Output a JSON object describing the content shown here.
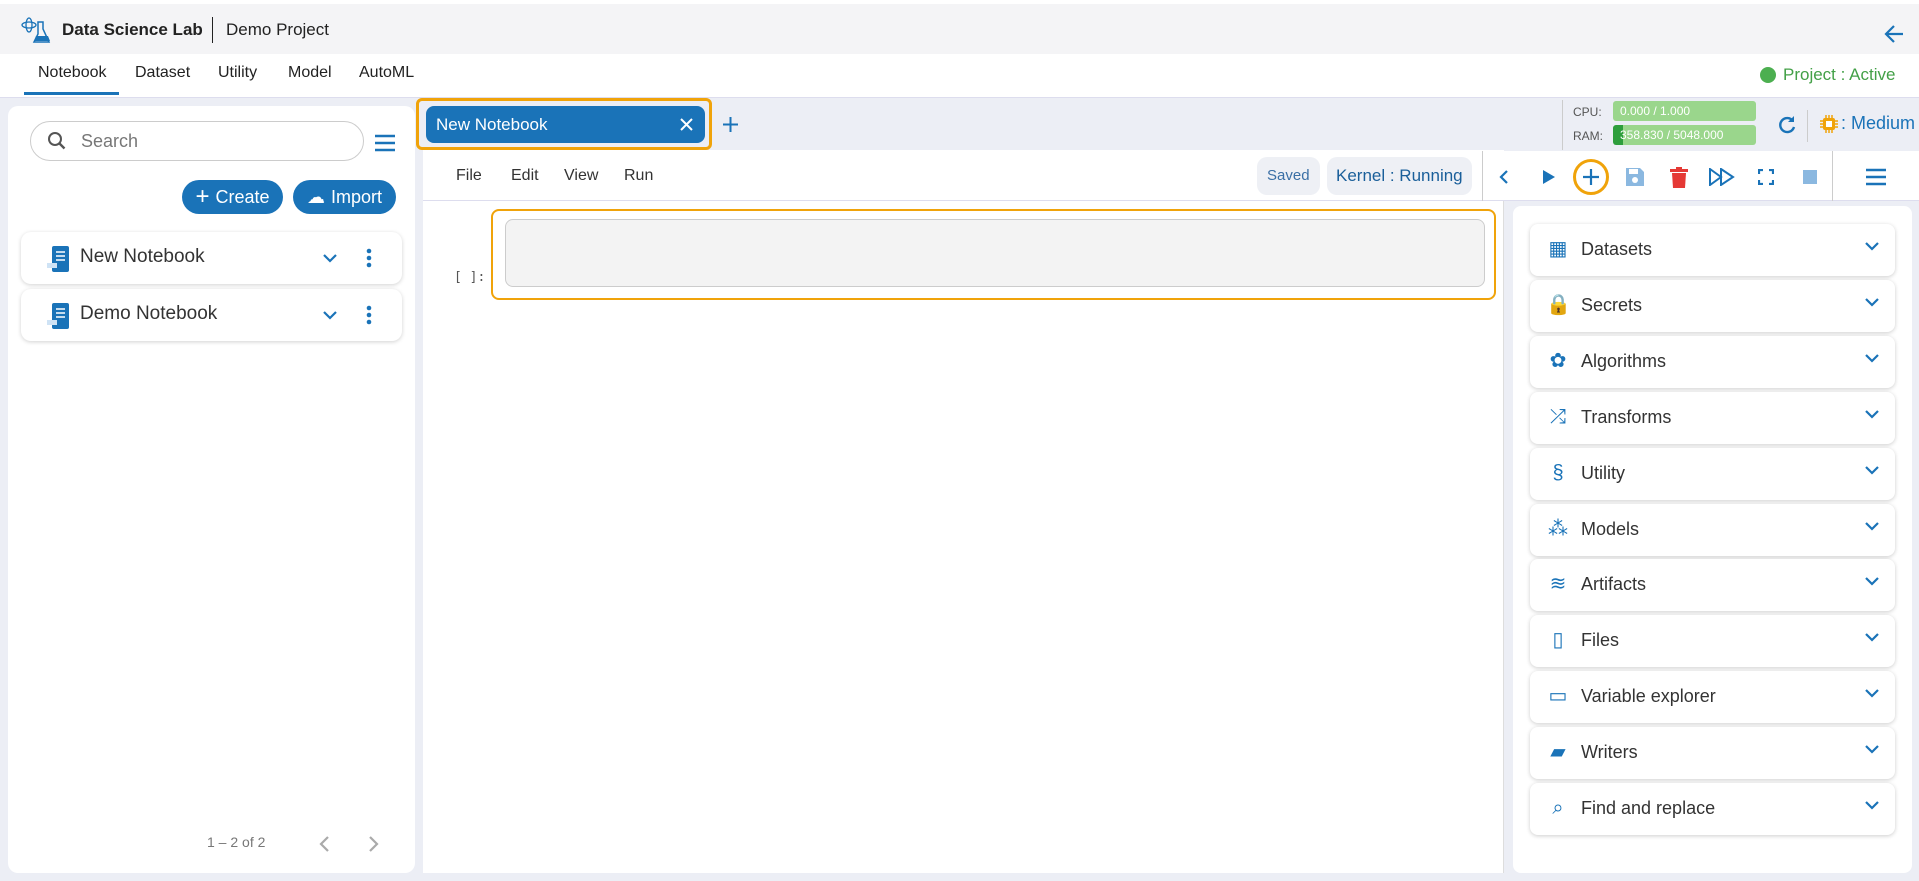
{
  "header": {
    "app_name": "Data Science Lab",
    "project": "Demo Project"
  },
  "nav": {
    "tabs": [
      "Notebook",
      "Dataset",
      "Utility",
      "Model",
      "AutoML"
    ],
    "status": "Project : Active"
  },
  "left": {
    "search_placeholder": "Search",
    "create": "Create",
    "import": "Import",
    "notebooks": [
      "New Notebook",
      "Demo Notebook"
    ],
    "pagination": "1 – 2 of 2"
  },
  "tabs": {
    "open": "New Notebook"
  },
  "resources": {
    "cpu_label": "CPU:",
    "cpu": "0.000 / 1.000",
    "cpu_fraction": 0.0,
    "ram_label": "RAM:",
    "ram": "358.830 / 5048.000",
    "ram_fraction": 0.071,
    "size": ": Medium"
  },
  "toolbar": {
    "menus": [
      "File",
      "Edit",
      "View",
      "Run"
    ],
    "saved": "Saved",
    "kernel": "Kernel : Running"
  },
  "cell": {
    "prompt": "[ ]:"
  },
  "panel": {
    "items": [
      "Datasets",
      "Secrets",
      "Algorithms",
      "Transforms",
      "Utility",
      "Models",
      "Artifacts",
      "Files",
      "Variable explorer",
      "Writers",
      "Find and replace"
    ]
  },
  "colors": {
    "primary": "#1a73b8",
    "highlight": "#f0a30a",
    "active": "#4caf50"
  }
}
